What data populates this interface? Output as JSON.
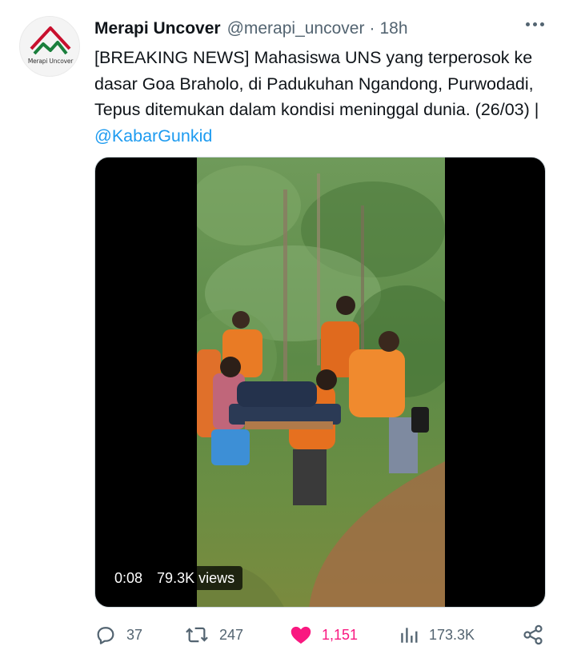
{
  "tweet": {
    "author": {
      "display_name": "Merapi Uncover",
      "handle": "@merapi_uncover",
      "time": "18h",
      "avatar_text": "Merapi Uncover"
    },
    "separator": "·",
    "text_main": "[BREAKING NEWS] Mahasiswa UNS yang terperosok ke dasar Goa Braholo, di Padukuhan Ngandong, Purwodadi, Tepus ditemukan dalam kondisi meninggal dunia. (26/03) | ",
    "mention": "@KabarGunkid"
  },
  "video": {
    "timestamp": "0:08",
    "views": "79.3K views"
  },
  "actions": {
    "reply_count": "37",
    "retweet_count": "247",
    "like_count": "1,151",
    "views_count": "173.3K"
  },
  "colors": {
    "accent": "#1d9bf0",
    "like": "#f91880",
    "secondary_text": "#536471"
  },
  "icons": [
    "more-icon",
    "reply-icon",
    "retweet-icon",
    "heart-icon",
    "views-icon",
    "share-icon"
  ]
}
